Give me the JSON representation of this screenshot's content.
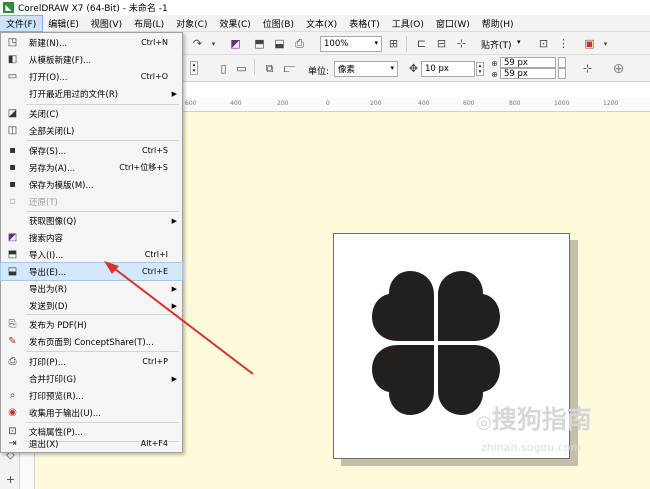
{
  "window": {
    "title": "CorelDRAW X7 (64-Bit) - 未命名 -1",
    "logo": "corel-logo"
  },
  "menubar": {
    "items": [
      "文件(F)",
      "编辑(E)",
      "视图(V)",
      "布局(L)",
      "对象(C)",
      "效果(C)",
      "位图(B)",
      "文本(X)",
      "表格(T)",
      "工具(O)",
      "窗口(W)",
      "帮助(H)"
    ]
  },
  "toolbar": {
    "zoom": "100%",
    "snap": "贴齐(T)",
    "units_label": "单位:",
    "units": "像素",
    "nudge": "10 px",
    "dup_x": "59 px",
    "dup_y": "59 px"
  },
  "ruler": {
    "ticks": [
      "600",
      "400",
      "200",
      "0",
      "200",
      "400",
      "600",
      "800",
      "1000",
      "1200"
    ]
  },
  "file_menu": {
    "items": [
      {
        "label": "新建(N)...",
        "shortcut": "Ctrl+N",
        "icon": "new-doc-icon"
      },
      {
        "label": "从模板新建(F)...",
        "shortcut": "",
        "icon": "template-icon"
      },
      {
        "label": "打开(O)...",
        "shortcut": "Ctrl+O",
        "icon": "open-folder-icon"
      },
      {
        "label": "打开最近用过的文件(R)",
        "shortcut": "",
        "icon": "",
        "submenu": true
      },
      {
        "label": "关闭(C)",
        "shortcut": "",
        "icon": "close-doc-icon"
      },
      {
        "label": "全部关闭(L)",
        "shortcut": "",
        "icon": "close-all-icon"
      },
      {
        "label": "保存(S)...",
        "shortcut": "Ctrl+S",
        "icon": "save-icon"
      },
      {
        "label": "另存为(A)...",
        "shortcut": "Ctrl+位移+S",
        "icon": "save-as-icon"
      },
      {
        "label": "保存为模版(M)...",
        "shortcut": "",
        "icon": "save-template-icon"
      },
      {
        "label": "还原(T)",
        "shortcut": "",
        "icon": "revert-icon",
        "disabled": true
      },
      {
        "label": "获取图像(Q)",
        "shortcut": "",
        "icon": "",
        "submenu": true
      },
      {
        "label": "搜索内容",
        "shortcut": "",
        "icon": "search-content-icon"
      },
      {
        "label": "导入(I)...",
        "shortcut": "Ctrl+I",
        "icon": "import-icon"
      },
      {
        "label": "导出(E)...",
        "shortcut": "Ctrl+E",
        "icon": "export-icon",
        "highlight": true
      },
      {
        "label": "导出为(R)",
        "shortcut": "",
        "icon": "",
        "submenu": true
      },
      {
        "label": "发送到(D)",
        "shortcut": "",
        "icon": "",
        "submenu": true
      },
      {
        "label": "发布为 PDF(H)",
        "shortcut": "",
        "icon": "pdf-icon"
      },
      {
        "label": "发布页面到 ConceptShare(T)...",
        "shortcut": "",
        "icon": "conceptshare-icon"
      },
      {
        "label": "打印(P)...",
        "shortcut": "Ctrl+P",
        "icon": "print-icon"
      },
      {
        "label": "合并打印(G)",
        "shortcut": "",
        "icon": "",
        "submenu": true
      },
      {
        "label": "打印预览(R)...",
        "shortcut": "",
        "icon": "print-preview-icon"
      },
      {
        "label": "收集用于输出(U)...",
        "shortcut": "",
        "icon": "collect-output-icon"
      },
      {
        "label": "文档属性(P)...",
        "shortcut": "",
        "icon": "doc-properties-icon"
      },
      {
        "label": "退出(X)",
        "shortcut": "Alt+F4",
        "icon": "exit-icon"
      }
    ]
  },
  "watermark": {
    "text": "搜狗指南",
    "url": "zhinan.sogou.com"
  },
  "colors": {
    "accent": "#d9302c",
    "canvas": "#fdfbd9",
    "clover": "#231f1c"
  }
}
